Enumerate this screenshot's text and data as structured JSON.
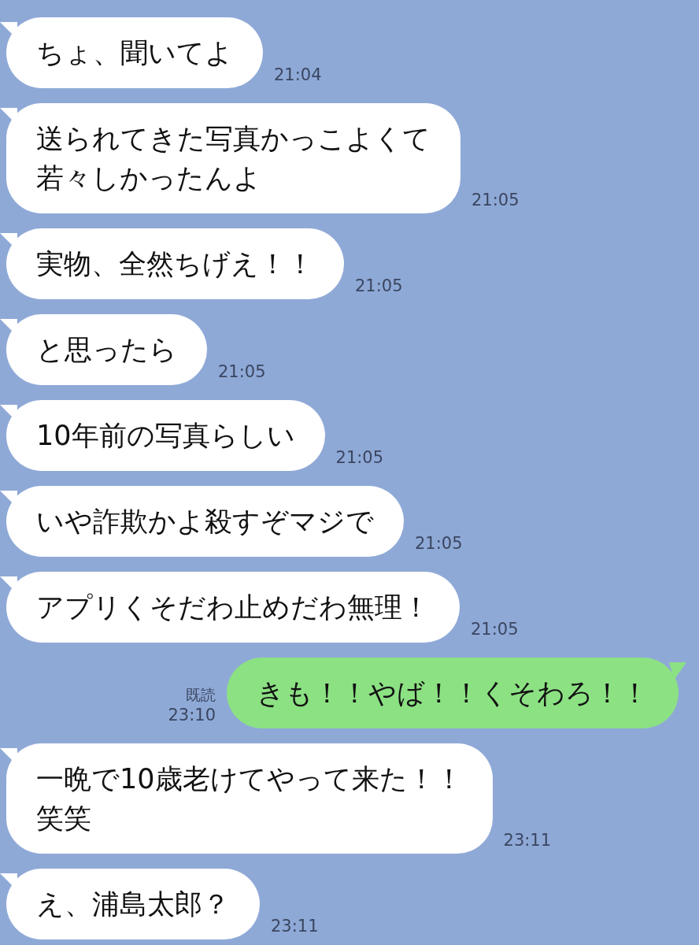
{
  "messages": [
    {
      "kind": "incoming",
      "text": "ちょ、聞いてよ",
      "time": "21:04"
    },
    {
      "kind": "incoming",
      "lines": [
        "送られてきた写真かっこよくて",
        "若々しかったんよ"
      ],
      "time": "21:05"
    },
    {
      "kind": "incoming",
      "text": "実物、全然ちげえ！！",
      "time": "21:05"
    },
    {
      "kind": "incoming",
      "text": "と思ったら",
      "time": "21:05"
    },
    {
      "kind": "incoming",
      "text": "10年前の写真らしい",
      "time": "21:05"
    },
    {
      "kind": "incoming",
      "text": "いや詐欺かよ殺すぞマジで",
      "time": "21:05"
    },
    {
      "kind": "incoming",
      "text": "アプリくそだわ止めだわ無理！",
      "time": "21:05"
    },
    {
      "kind": "outgoing",
      "text": "きも！！やば！！くそわろ！！",
      "time": "23:10",
      "read": "既読"
    },
    {
      "kind": "incoming",
      "lines": [
        "一晩で10歳老けてやって来た！！",
        "笑笑"
      ],
      "time": "23:11"
    },
    {
      "kind": "incoming",
      "text": "え、浦島太郎？",
      "time": "23:11"
    }
  ]
}
